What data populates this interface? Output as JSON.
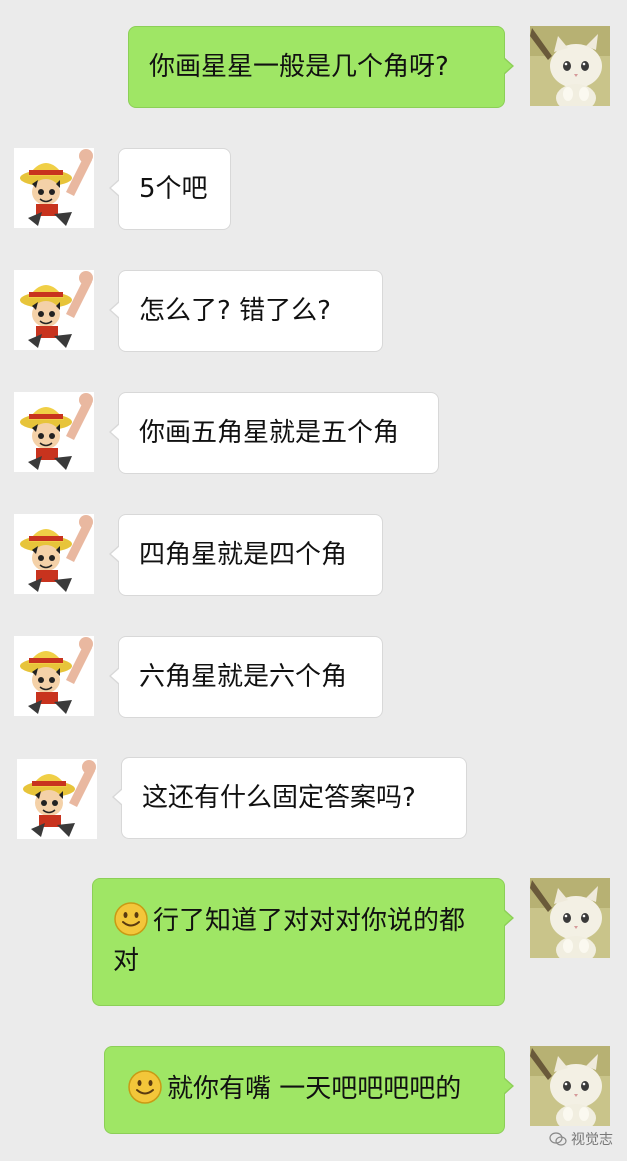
{
  "colors": {
    "background": "#ebebeb",
    "incoming_bubble": "#ffffff",
    "outgoing_bubble": "#9fe665"
  },
  "messages": [
    {
      "sender": "me",
      "avatar": "kitten-avatar",
      "text": "你画星星一般是几个角呀?"
    },
    {
      "sender": "friend",
      "avatar": "straw-hat-avatar",
      "text": "5个吧"
    },
    {
      "sender": "friend",
      "avatar": "straw-hat-avatar",
      "text": "怎么了? 错了么?"
    },
    {
      "sender": "friend",
      "avatar": "straw-hat-avatar",
      "text": "你画五角星就是五个角"
    },
    {
      "sender": "friend",
      "avatar": "straw-hat-avatar",
      "text": "四角星就是四个角"
    },
    {
      "sender": "friend",
      "avatar": "straw-hat-avatar",
      "text": "六角星就是六个角"
    },
    {
      "sender": "friend",
      "avatar": "straw-hat-avatar",
      "text": "这还有什么固定答案吗?"
    },
    {
      "sender": "me",
      "avatar": "kitten-avatar",
      "emoji": "smiley-emoji",
      "text": "行了知道了对对对你说的都对"
    },
    {
      "sender": "me",
      "avatar": "kitten-avatar",
      "emoji": "smiley-emoji",
      "text": "就你有嘴 一天吧吧吧吧的"
    }
  ],
  "watermark": {
    "text": "视觉志",
    "icon": "wechat-icon"
  }
}
